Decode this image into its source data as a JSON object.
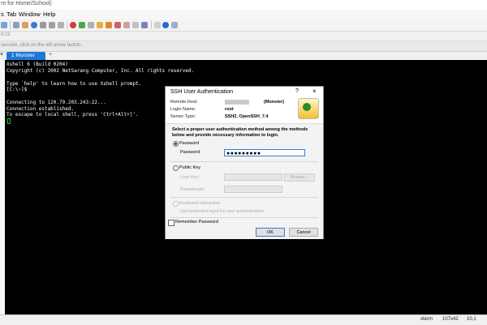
{
  "window": {
    "title": "re for Home/School)"
  },
  "menu": [
    "s",
    "Tab",
    "Window",
    "Help"
  ],
  "address": "0:22",
  "hint": "session, click on the left arrow button.",
  "tabs": [
    {
      "label": "1 Monster",
      "active": true
    }
  ],
  "tab_add": "+",
  "tab_close": "×",
  "terminal": {
    "lines": [
      "Xshell 6 (Build 0204)",
      "Copyright (c) 2002 NetSarang Computer, Inc. All rights reserved.",
      "",
      "Type `help' to learn how to use Xshell prompt.",
      "[C:\\~]$",
      "",
      "Connecting to 120.79.203.243:22...",
      "Connection established.",
      "To escape to local shell, press 'Ctrl+Alt+]'."
    ]
  },
  "dialog": {
    "title": "SSH User Authentication",
    "help": "?",
    "close": "×",
    "remote_host_label": "Remote Host:",
    "remote_host_value": "(Monster)",
    "login_name_label": "Login Name:",
    "login_name_value": "root",
    "server_type_label": "Server Type:",
    "server_type_value": "SSH2, OpenSSH_7.4",
    "instructions": "Select a proper user authentication method among the methods below and provide necessary information to login.",
    "password_radio": "Password",
    "password_label": "Password:",
    "password_value": "●●●●●●●●●",
    "public_key_radio": "Public Key",
    "user_key_label": "User Key:",
    "browse_button": "Browse...",
    "passphrase_label": "Passphrase:",
    "keyboard_radio": "Keyboard Interactive",
    "keyboard_hint": "Use keyboard input for user authentication",
    "remember": "Remember Password",
    "ok": "OK",
    "cancel": "Cancel",
    "selected_method": "Password"
  },
  "status": {
    "term": "xterm",
    "size": "107x42",
    "pos": "10,1"
  },
  "colors": {
    "tab_active": "#1e78d7",
    "terminal_bg": "#000000",
    "terminal_fg": "#ffffff",
    "cursor": "#1ec21e"
  }
}
